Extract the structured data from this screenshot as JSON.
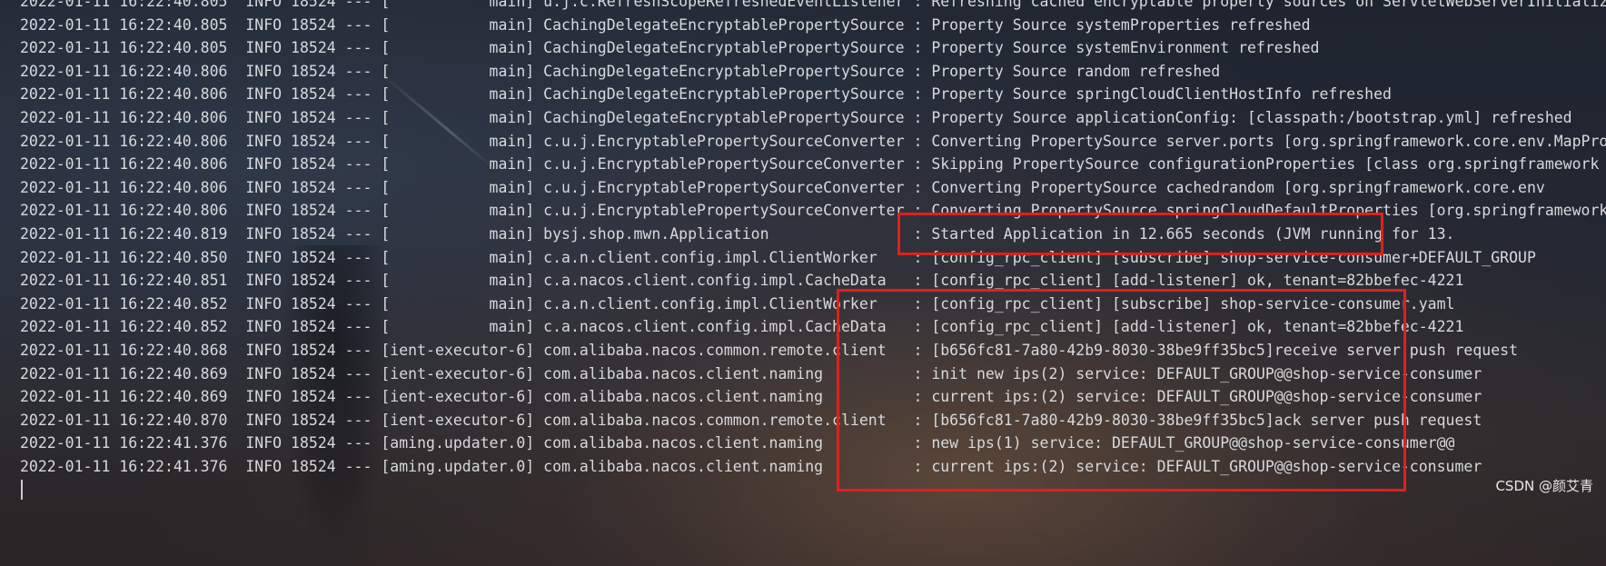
{
  "console": {
    "lines": [
      "2022-01-11 16:22:40.805  INFO 18524 --- [           main] u.j.c.RefreshScopeRefreshedEventListener : Refreshing cached encryptable property sources on ServletWebServerInitializedEvent",
      "2022-01-11 16:22:40.805  INFO 18524 --- [           main] CachingDelegateEncryptablePropertySource : Property Source systemProperties refreshed",
      "2022-01-11 16:22:40.805  INFO 18524 --- [           main] CachingDelegateEncryptablePropertySource : Property Source systemEnvironment refreshed",
      "2022-01-11 16:22:40.806  INFO 18524 --- [           main] CachingDelegateEncryptablePropertySource : Property Source random refreshed",
      "2022-01-11 16:22:40.806  INFO 18524 --- [           main] CachingDelegateEncryptablePropertySource : Property Source springCloudClientHostInfo refreshed",
      "2022-01-11 16:22:40.806  INFO 18524 --- [           main] CachingDelegateEncryptablePropertySource : Property Source applicationConfig: [classpath:/bootstrap.yml] refreshed",
      "2022-01-11 16:22:40.806  INFO 18524 --- [           main] c.u.j.EncryptablePropertySourceConverter : Converting PropertySource server.ports [org.springframework.core.env.MapPropertySource]",
      "2022-01-11 16:22:40.806  INFO 18524 --- [           main] c.u.j.EncryptablePropertySourceConverter : Skipping PropertySource configurationProperties [class org.springframework",
      "2022-01-11 16:22:40.806  INFO 18524 --- [           main] c.u.j.EncryptablePropertySourceConverter : Converting PropertySource cachedrandom [org.springframework.core.env",
      "2022-01-11 16:22:40.806  INFO 18524 --- [           main] c.u.j.EncryptablePropertySourceConverter : Converting PropertySource springCloudDefaultProperties [org.springframework",
      "2022-01-11 16:22:40.819  INFO 18524 --- [           main] bysj.shop.mwn.Application                : Started Application in 12.665 seconds (JVM running for 13.",
      "2022-01-11 16:22:40.850  INFO 18524 --- [           main] c.a.n.client.config.impl.ClientWorker    : [config_rpc_client] [subscribe] shop-service-consumer+DEFAULT_GROUP",
      "2022-01-11 16:22:40.851  INFO 18524 --- [           main] c.a.nacos.client.config.impl.CacheData   : [config_rpc_client] [add-listener] ok, tenant=82bbefec-4221",
      "2022-01-11 16:22:40.852  INFO 18524 --- [           main] c.a.n.client.config.impl.ClientWorker    : [config_rpc_client] [subscribe] shop-service-consumer.yaml",
      "2022-01-11 16:22:40.852  INFO 18524 --- [           main] c.a.nacos.client.config.impl.CacheData   : [config_rpc_client] [add-listener] ok, tenant=82bbefec-4221",
      "2022-01-11 16:22:40.868  INFO 18524 --- [ient-executor-6] com.alibaba.nacos.common.remote.client   : [b656fc81-7a80-42b9-8030-38be9ff35bc5]receive server push request",
      "2022-01-11 16:22:40.869  INFO 18524 --- [ient-executor-6] com.alibaba.nacos.client.naming          : init new ips(2) service: DEFAULT_GROUP@@shop-service-consumer",
      "2022-01-11 16:22:40.869  INFO 18524 --- [ient-executor-6] com.alibaba.nacos.client.naming          : current ips:(2) service: DEFAULT_GROUP@@shop-service-consumer",
      "2022-01-11 16:22:40.870  INFO 18524 --- [ient-executor-6] com.alibaba.nacos.common.remote.client   : [b656fc81-7a80-42b9-8030-38be9ff35bc5]ack server push request",
      "2022-01-11 16:22:41.376  INFO 18524 --- [aming.updater.0] com.alibaba.nacos.client.naming          : new ips(1) service: DEFAULT_GROUP@@shop-service-consumer@@",
      "2022-01-11 16:22:41.376  INFO 18524 --- [aming.updater.0] com.alibaba.nacos.client.naming          : current ips:(2) service: DEFAULT_GROUP@@shop-service-consumer"
    ]
  },
  "watermark": "CSDN @颜艾青",
  "colors": {
    "text": "#d7d9dc",
    "highlight_box": "#e0201c"
  }
}
